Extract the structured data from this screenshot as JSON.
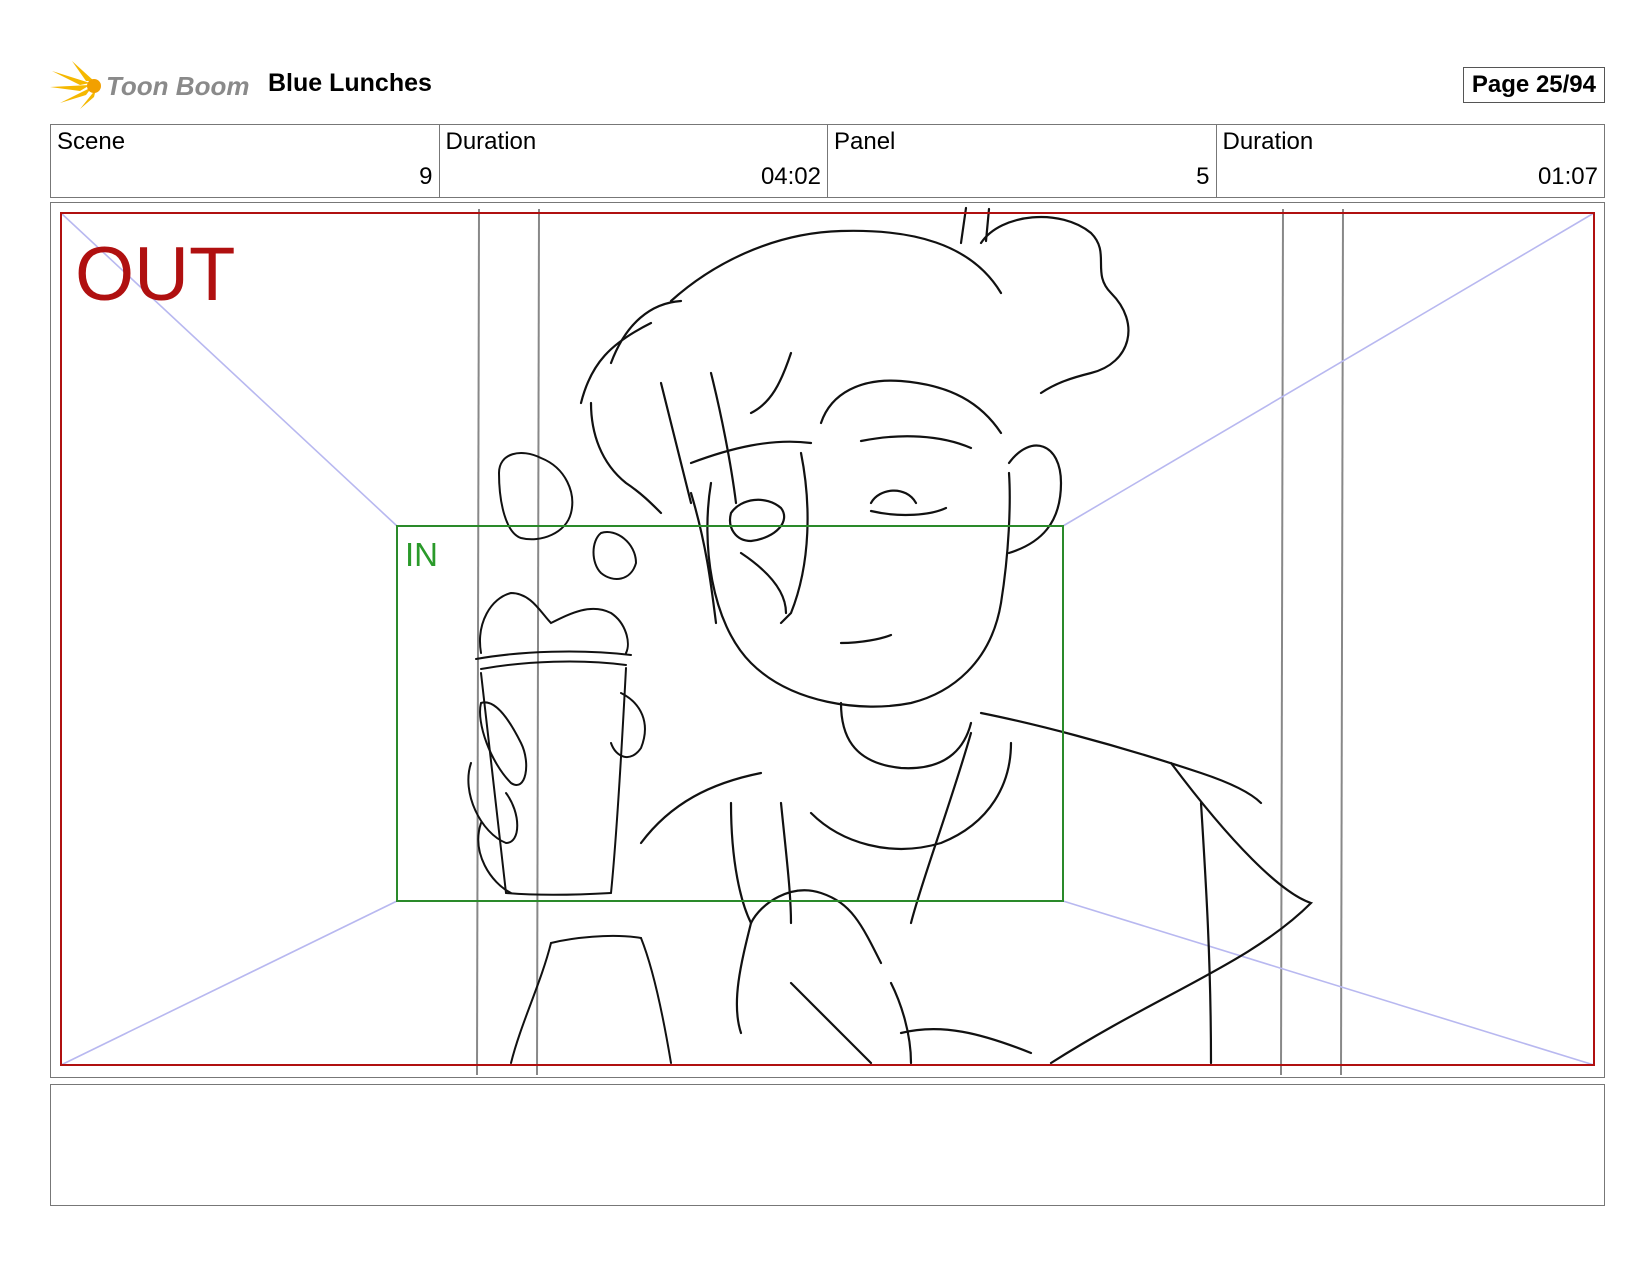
{
  "header": {
    "logo_text": "Toon Boom",
    "title": "Blue Lunches",
    "page": "Page 25/94"
  },
  "info": {
    "scene_label": "Scene",
    "scene_value": "9",
    "scene_duration_label": "Duration",
    "scene_duration_value": "04:02",
    "panel_label": "Panel",
    "panel_value": "5",
    "panel_duration_label": "Duration",
    "panel_duration_value": "01:07"
  },
  "frame": {
    "out_label": "OUT",
    "in_label": "IN",
    "out_color": "#b01010",
    "in_color": "#2a8a2a"
  },
  "notes": {
    "text": ""
  }
}
